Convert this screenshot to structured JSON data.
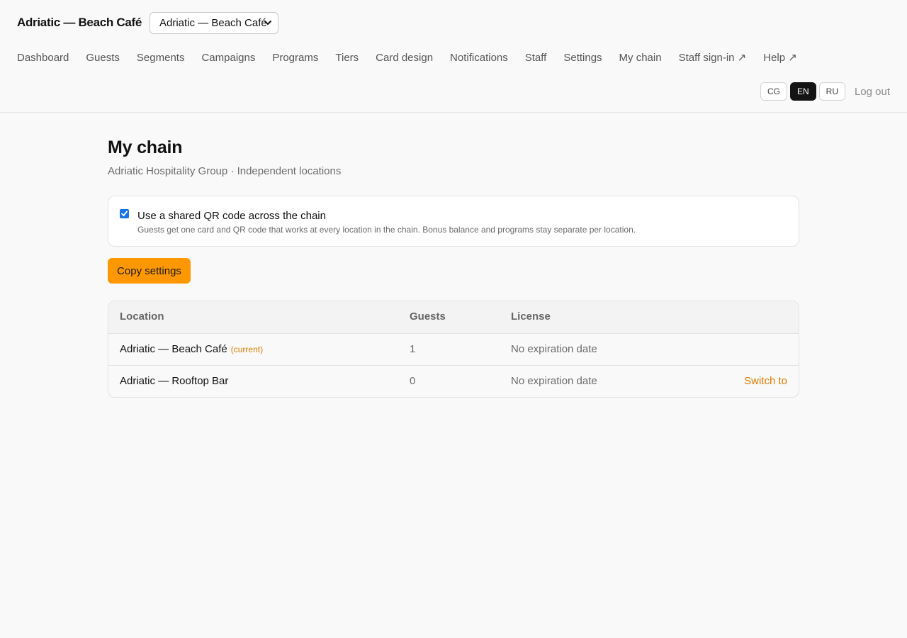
{
  "header": {
    "brand": "Adriatic — Beach Café",
    "location_select": {
      "value": "Adriatic — Beach Café"
    },
    "nav": [
      {
        "label": "Dashboard",
        "name": "nav-dashboard"
      },
      {
        "label": "Guests",
        "name": "nav-guests"
      },
      {
        "label": "Segments",
        "name": "nav-segments"
      },
      {
        "label": "Campaigns",
        "name": "nav-campaigns"
      },
      {
        "label": "Programs",
        "name": "nav-programs"
      },
      {
        "label": "Tiers",
        "name": "nav-tiers"
      },
      {
        "label": "Card design",
        "name": "nav-card-design"
      },
      {
        "label": "Notifications",
        "name": "nav-notifications"
      },
      {
        "label": "Staff",
        "name": "nav-staff"
      },
      {
        "label": "Settings",
        "name": "nav-settings"
      },
      {
        "label": "My chain",
        "name": "nav-my-chain"
      },
      {
        "label": "Staff sign-in ↗",
        "name": "nav-staff-sign-in"
      },
      {
        "label": "Help ↗",
        "name": "nav-help"
      }
    ],
    "languages": [
      "CG",
      "EN",
      "RU"
    ],
    "active_language": "EN",
    "logout": "Log out"
  },
  "page": {
    "title": "My chain",
    "subtitle": "Adriatic Hospitality Group · Independent locations",
    "shared_qr": {
      "checked": true,
      "label": "Use a shared QR code across the chain",
      "help": "Guests get one card and QR code that works at every location in the chain. Bonus balance and programs stay separate per location."
    },
    "copy_button": "Copy settings",
    "table": {
      "headers": [
        "Location",
        "Guests",
        "License"
      ],
      "rows": [
        {
          "location": "Adriatic — Beach Café",
          "tag": "(current)",
          "guests": "1",
          "license": "No expiration date",
          "action": ""
        },
        {
          "location": "Adriatic — Rooftop Bar",
          "tag": "",
          "guests": "0",
          "license": "No expiration date",
          "action": "Switch to"
        }
      ]
    }
  },
  "colors": {
    "accent": "#ff9800",
    "link_accent": "#e07a00",
    "checkbox": "#1a73e8",
    "active_lang_bg": "#141414"
  }
}
